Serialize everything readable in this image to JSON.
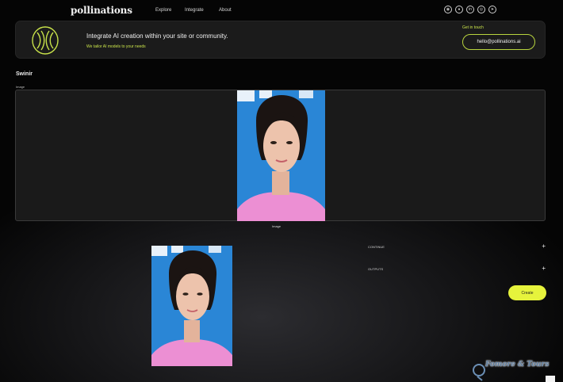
{
  "brand": "pollinations",
  "nav": {
    "explore": "Explore",
    "integrate": "Integrate",
    "about": "About"
  },
  "socials": [
    {
      "icon": "discord-icon"
    },
    {
      "icon": "github-icon"
    },
    {
      "icon": "linkedin-icon"
    },
    {
      "icon": "instagram-icon"
    },
    {
      "icon": "telegram-icon"
    }
  ],
  "banner": {
    "title": "Integrate AI creation within your site or community.",
    "subtitle": "We tailor AI models to your needs",
    "touch_label": "Get in touch",
    "email": "hello@pollinations.ai"
  },
  "section": {
    "title": "Swinir",
    "input_label": "Image"
  },
  "caption": "Image",
  "params": {
    "first_label": "CONTINUE",
    "second_label": "OUTPUTS",
    "plus": "+"
  },
  "create_button": "Create",
  "watermark": "Fomore & Tours",
  "colors": {
    "accent": "#e6f33c",
    "accent_text": "#c8e24a",
    "panel": "#1b1b1b",
    "photo_background": "#2a86d6",
    "photo_top": "#ec8fd3"
  }
}
